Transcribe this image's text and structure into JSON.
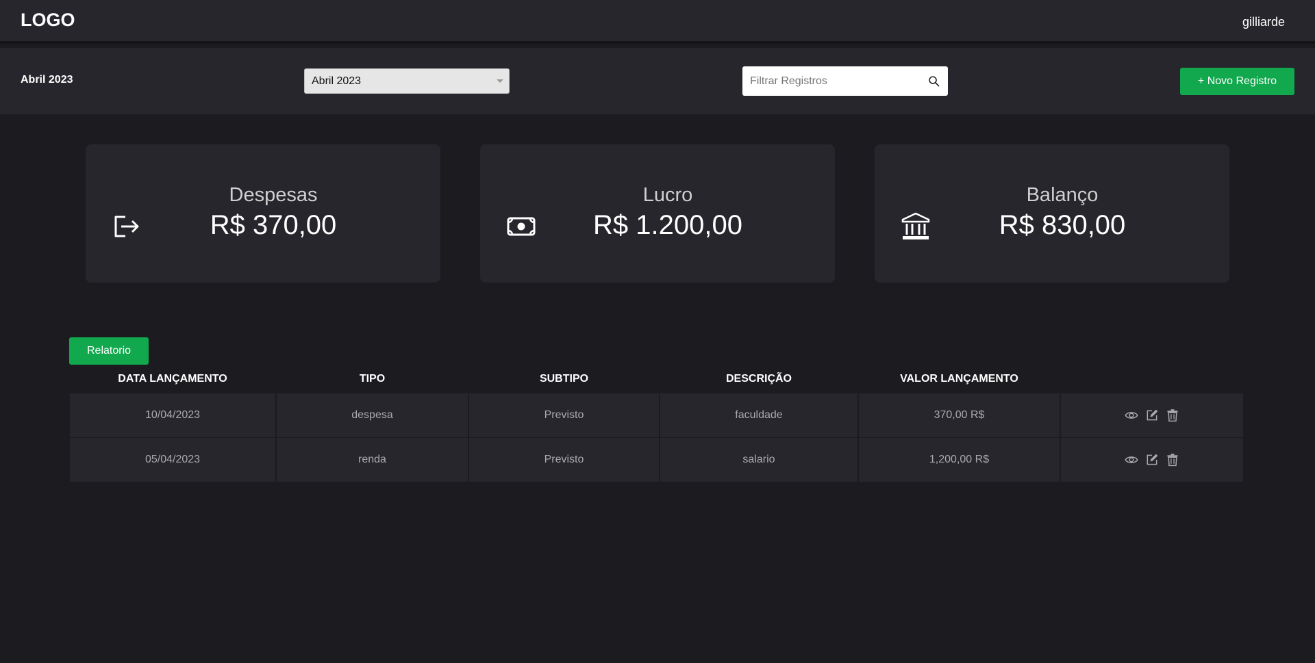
{
  "header": {
    "logo": "LOGO",
    "username": "gilliarde"
  },
  "toolbar": {
    "month_title": "Abril 2023",
    "month_select": {
      "value": "Abril 2023"
    },
    "search": {
      "placeholder": "Filtrar Registros",
      "value": ""
    },
    "new_button_label": "+ Novo Registro"
  },
  "cards": [
    {
      "label": "Despesas",
      "value": "R$ 370,00",
      "icon": "sign-out-icon"
    },
    {
      "label": "Lucro",
      "value": "R$ 1.200,00",
      "icon": "money-bill-icon"
    },
    {
      "label": "Balanço",
      "value": "R$ 830,00",
      "icon": "bank-icon"
    }
  ],
  "report_button_label": "Relatorio",
  "table": {
    "headers": [
      "DATA LANÇAMENTO",
      "TIPO",
      "SUBTIPO",
      "DESCRIÇÃO",
      "VALOR LANÇAMENTO"
    ],
    "rows": [
      {
        "date": "10/04/2023",
        "type": "despesa",
        "subtype": "Previsto",
        "description": "faculdade",
        "value": "370,00 R$"
      },
      {
        "date": "05/04/2023",
        "type": "renda",
        "subtype": "Previsto",
        "description": "salario",
        "value": "1,200,00 R$"
      }
    ],
    "row_actions": [
      "eye-icon",
      "edit-icon",
      "trash-icon"
    ]
  },
  "colors": {
    "background": "#1b1b20",
    "panel": "#26262c",
    "accent_green": "#12a84e"
  }
}
